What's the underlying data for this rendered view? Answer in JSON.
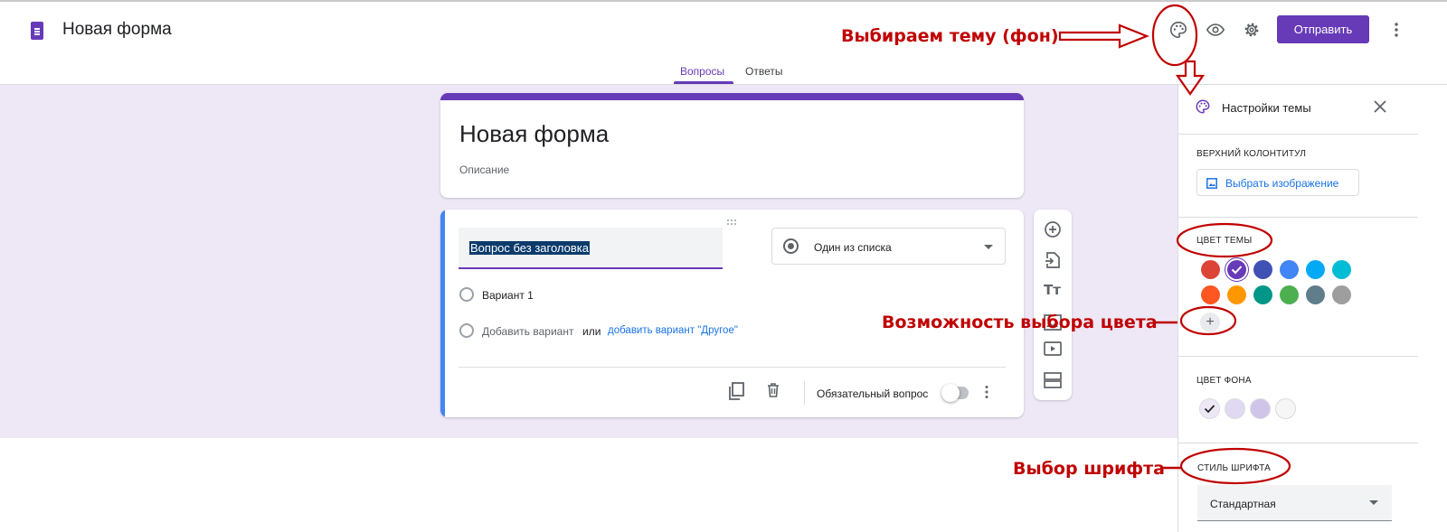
{
  "app": {
    "title": "Новая форма",
    "send_label": "Отправить"
  },
  "tabs": [
    {
      "label": "Вопросы",
      "active": true
    },
    {
      "label": "Ответы",
      "active": false
    }
  ],
  "colors": {
    "accent": "#673ab7",
    "canvas_bg": "#ede7f6",
    "annotation": "#c00000",
    "link": "#1a73e8"
  },
  "form": {
    "title": "Новая форма",
    "description_placeholder": "Описание"
  },
  "question": {
    "title": "Вопрос без заголовка",
    "type": "Один из списка",
    "option1": "Вариант 1",
    "add_option": "Добавить вариант",
    "or": "или",
    "add_other": "добавить вариант \"Другое\"",
    "required_label": "Обязательный вопрос",
    "required": false
  },
  "theme_panel": {
    "title": "Настройки темы",
    "header_section": "ВЕРХНИЙ КОЛОНТИТУЛ",
    "pick_image": "Выбрать изображение",
    "theme_color_section": "ЦВЕТ ТЕМЫ",
    "theme_colors": [
      "#db4437",
      "#673ab7",
      "#3f51b5",
      "#4285f4",
      "#03a9f4",
      "#00bcd4",
      "#ff5722",
      "#ff9800",
      "#009688",
      "#4caf50",
      "#607d8b",
      "#9e9e9e"
    ],
    "selected_theme_color": "#673ab7",
    "bg_color_section": "ЦВЕТ ФОНА",
    "bg_colors": [
      "#ede7f6",
      "#e1d8f1",
      "#d1c4e9",
      "#f6f6f6"
    ],
    "font_section": "СТИЛЬ ШРИФТА",
    "font_value": "Стандартная"
  },
  "annotations": {
    "choose_theme": "Выбираем тему (фон)",
    "color_choice": "Возможность выбора цвета",
    "font_choice": "Выбор шрифта"
  }
}
